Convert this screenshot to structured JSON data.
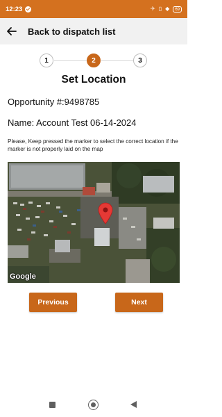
{
  "status_bar": {
    "time": "12:23",
    "battery": "69",
    "accent_color": "#d4711f"
  },
  "app_bar": {
    "back_icon": "arrow-left-icon",
    "title": "Back to dispatch list"
  },
  "stepper": {
    "steps": [
      "1",
      "2",
      "3"
    ],
    "active_step": "2",
    "active_color": "#c8671a"
  },
  "page": {
    "title": "Set Location",
    "opportunity": "Opportunity #:9498785",
    "name": "Name: Account Test 06-14-2024",
    "instruction": "Please, Keep pressed the marker to select the correct location if the marker is not properly laid on the map"
  },
  "map": {
    "provider_logo": "Google",
    "marker_icon": "map-pin-icon",
    "marker_color": "#e53935"
  },
  "buttons": {
    "previous": "Previous",
    "next": "Next"
  },
  "nav": {
    "icons": [
      "recents-square-icon",
      "home-circle-icon",
      "back-triangle-icon"
    ]
  }
}
